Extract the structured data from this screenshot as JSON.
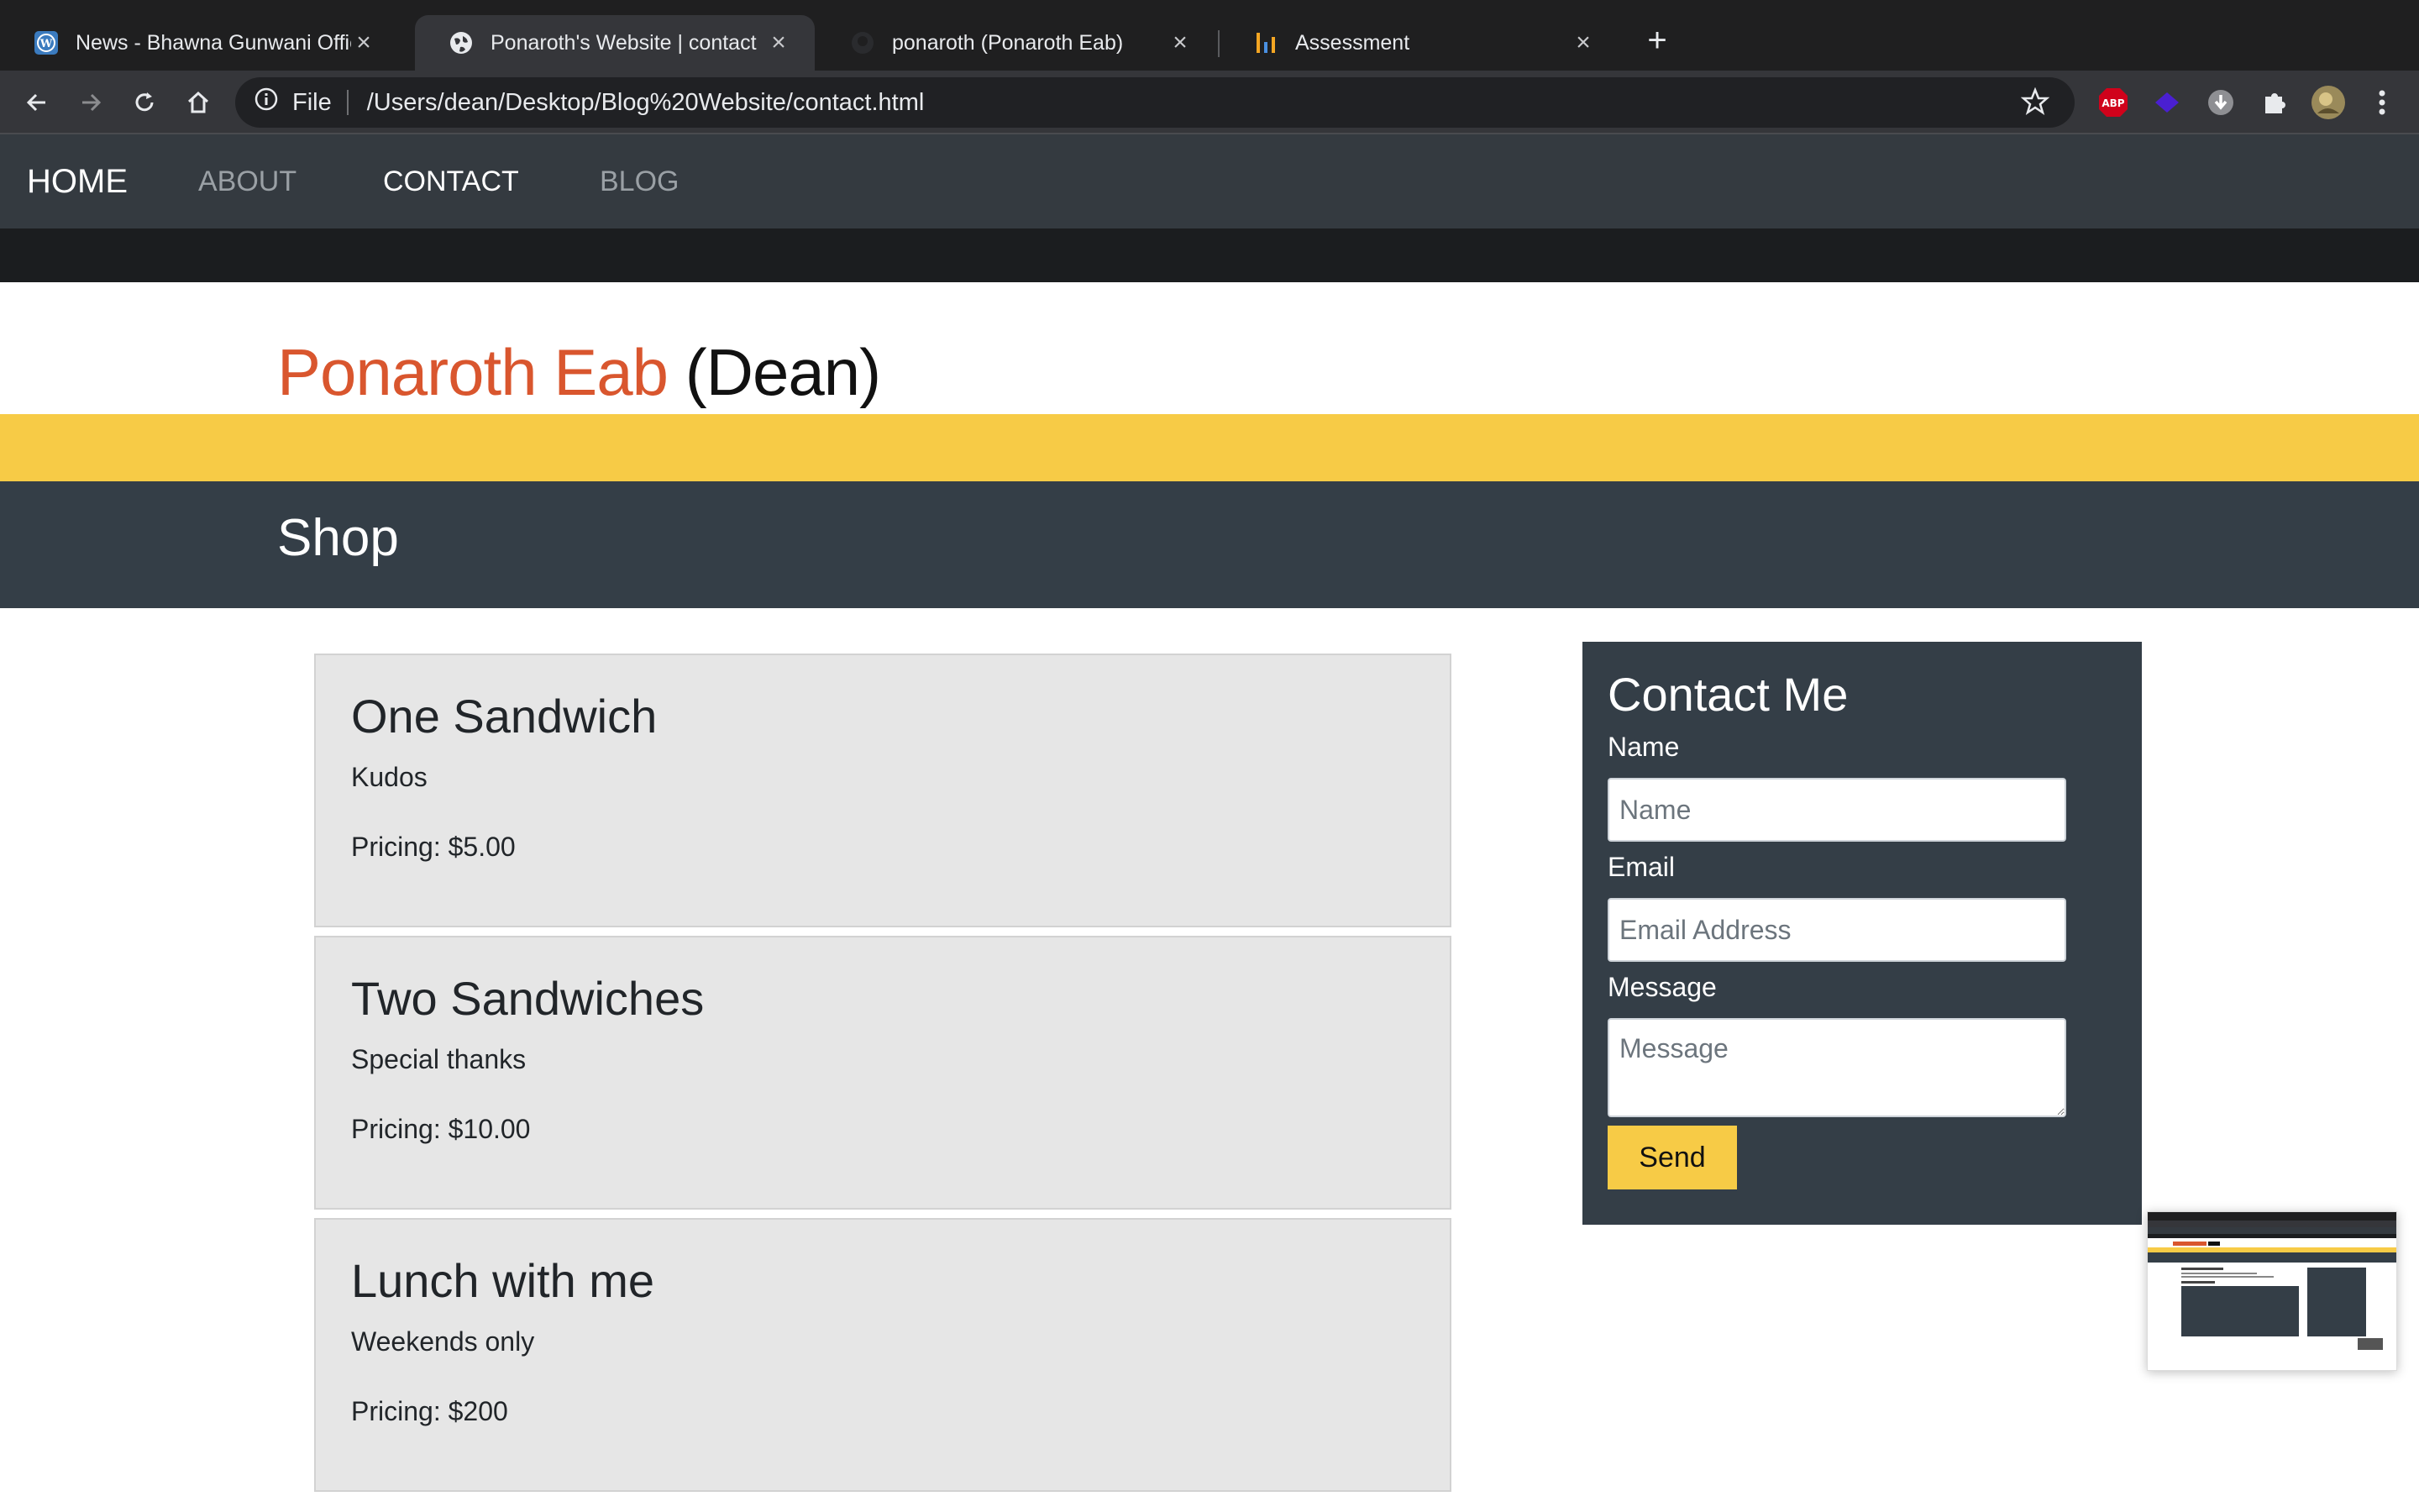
{
  "browser": {
    "tabs": [
      {
        "title": "News - Bhawna Gunwani Offici",
        "icon": "wordpress-icon",
        "active": false
      },
      {
        "title": "Ponaroth's Website | contact",
        "icon": "globe-icon",
        "active": true
      },
      {
        "title": "ponaroth (Ponaroth Eab)",
        "icon": "github-icon",
        "active": false
      },
      {
        "title": "Assessment",
        "icon": "bar-chart-icon",
        "active": false
      }
    ],
    "url_scheme": "File",
    "url": "/Users/dean/Desktop/Blog%20Website/contact.html",
    "extensions": [
      "adblock-plus-icon",
      "diamond-extension-icon",
      "download-icon",
      "puzzle-icon",
      "profile-avatar"
    ],
    "adblock_label": "ABP"
  },
  "nav": {
    "brand": "HOME",
    "links": [
      "ABOUT",
      "CONTACT",
      "BLOG"
    ],
    "active": "CONTACT"
  },
  "header": {
    "name": "Ponaroth Eab",
    "nickname": "(Dean)"
  },
  "section": {
    "title": "Shop"
  },
  "products": [
    {
      "name": "One Sandwich",
      "description": "Kudos",
      "price": "Pricing: $5.00"
    },
    {
      "name": "Two Sandwiches",
      "description": "Special thanks",
      "price": "Pricing: $10.00"
    },
    {
      "name": "Lunch with me",
      "description": "Weekends only",
      "price": "Pricing: $200"
    }
  ],
  "contact": {
    "title": "Contact Me",
    "name_label": "Name",
    "name_placeholder": "Name",
    "email_label": "Email",
    "email_placeholder": "Email Address",
    "message_label": "Message",
    "message_placeholder": "Message",
    "send_label": "Send"
  },
  "colors": {
    "accent_orange": "#d9562e",
    "accent_yellow": "#f7cb46",
    "navbar": "#343a40",
    "section_band": "#343e47",
    "card_bg": "#e6e6e6"
  }
}
